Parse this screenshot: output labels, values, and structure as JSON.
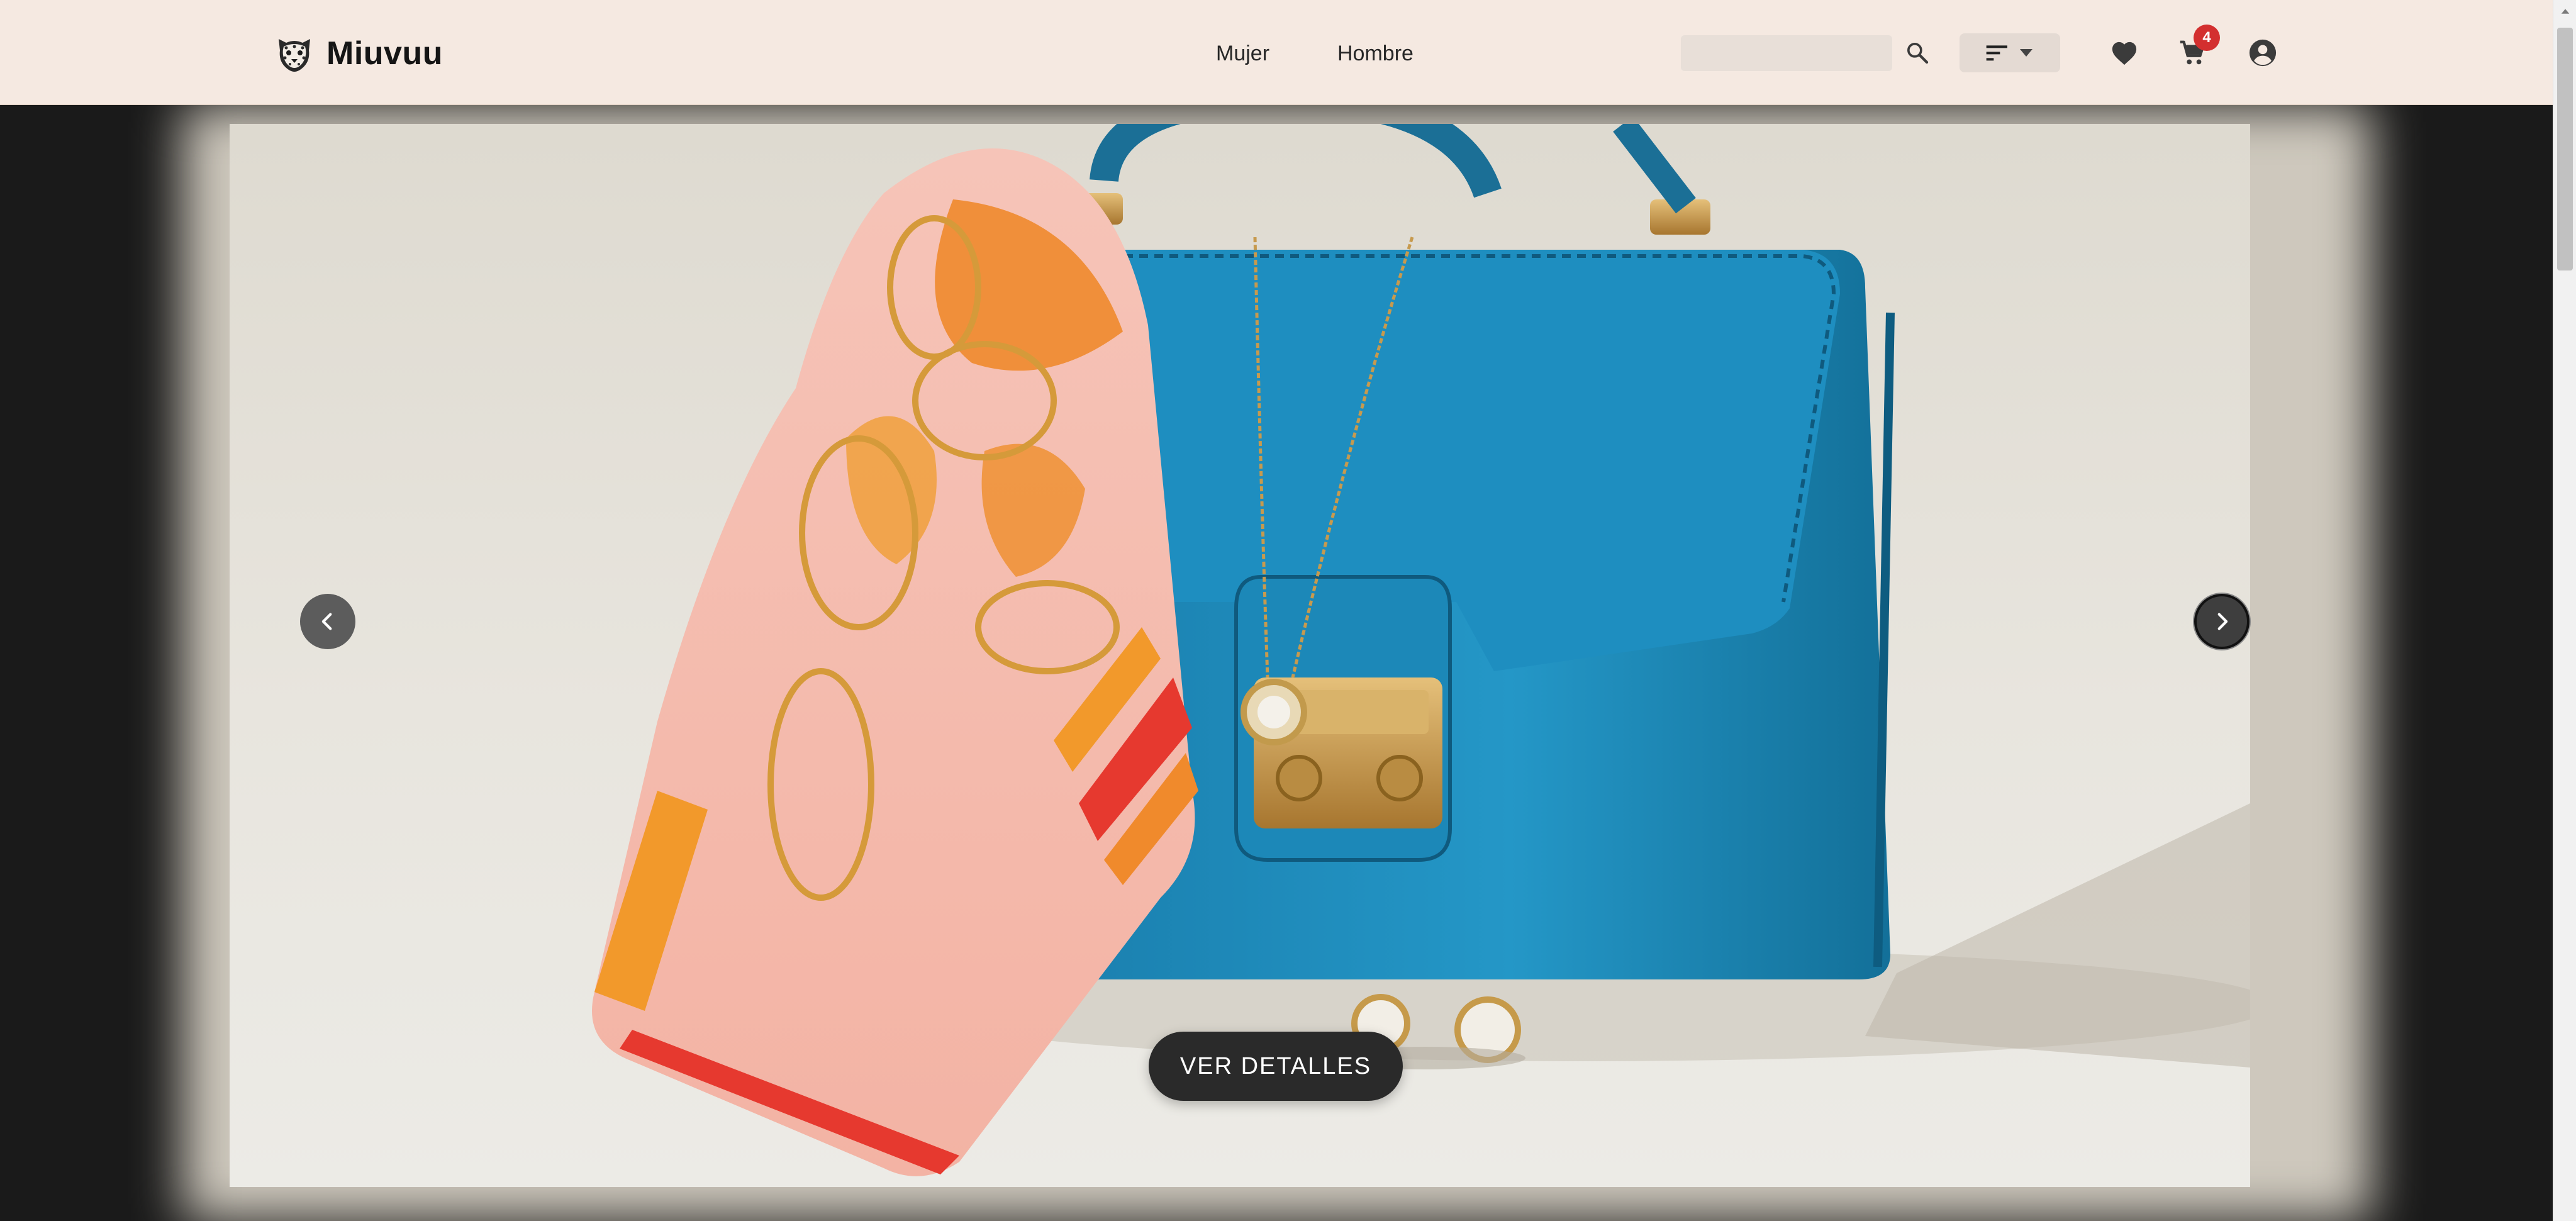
{
  "brand": {
    "name": "Miuvuu",
    "logo_icon": "leopard-head-icon"
  },
  "nav": {
    "women_label": "Mujer",
    "men_label": "Hombre"
  },
  "search": {
    "value": "",
    "placeholder": "",
    "icon": "search-icon"
  },
  "sort": {
    "icon": "sort-icon",
    "caret_icon": "caret-down-icon"
  },
  "actions": {
    "favorites_icon": "heart-icon",
    "cart_icon": "cart-icon",
    "cart_count": "4",
    "account_icon": "account-circle-icon"
  },
  "carousel": {
    "slide_image": "handbag-scarf-earrings-photo",
    "prev_icon": "chevron-left-icon",
    "next_icon": "chevron-right-icon",
    "cta_label": "VER DETALLES"
  },
  "colors": {
    "header_bg": "#f5e9e1",
    "hero_bg": "#1a1a1a",
    "cta_bg": "#2a2a2a",
    "badge_bg": "#d32f2f",
    "bag_blue": "#1f8fbf"
  }
}
